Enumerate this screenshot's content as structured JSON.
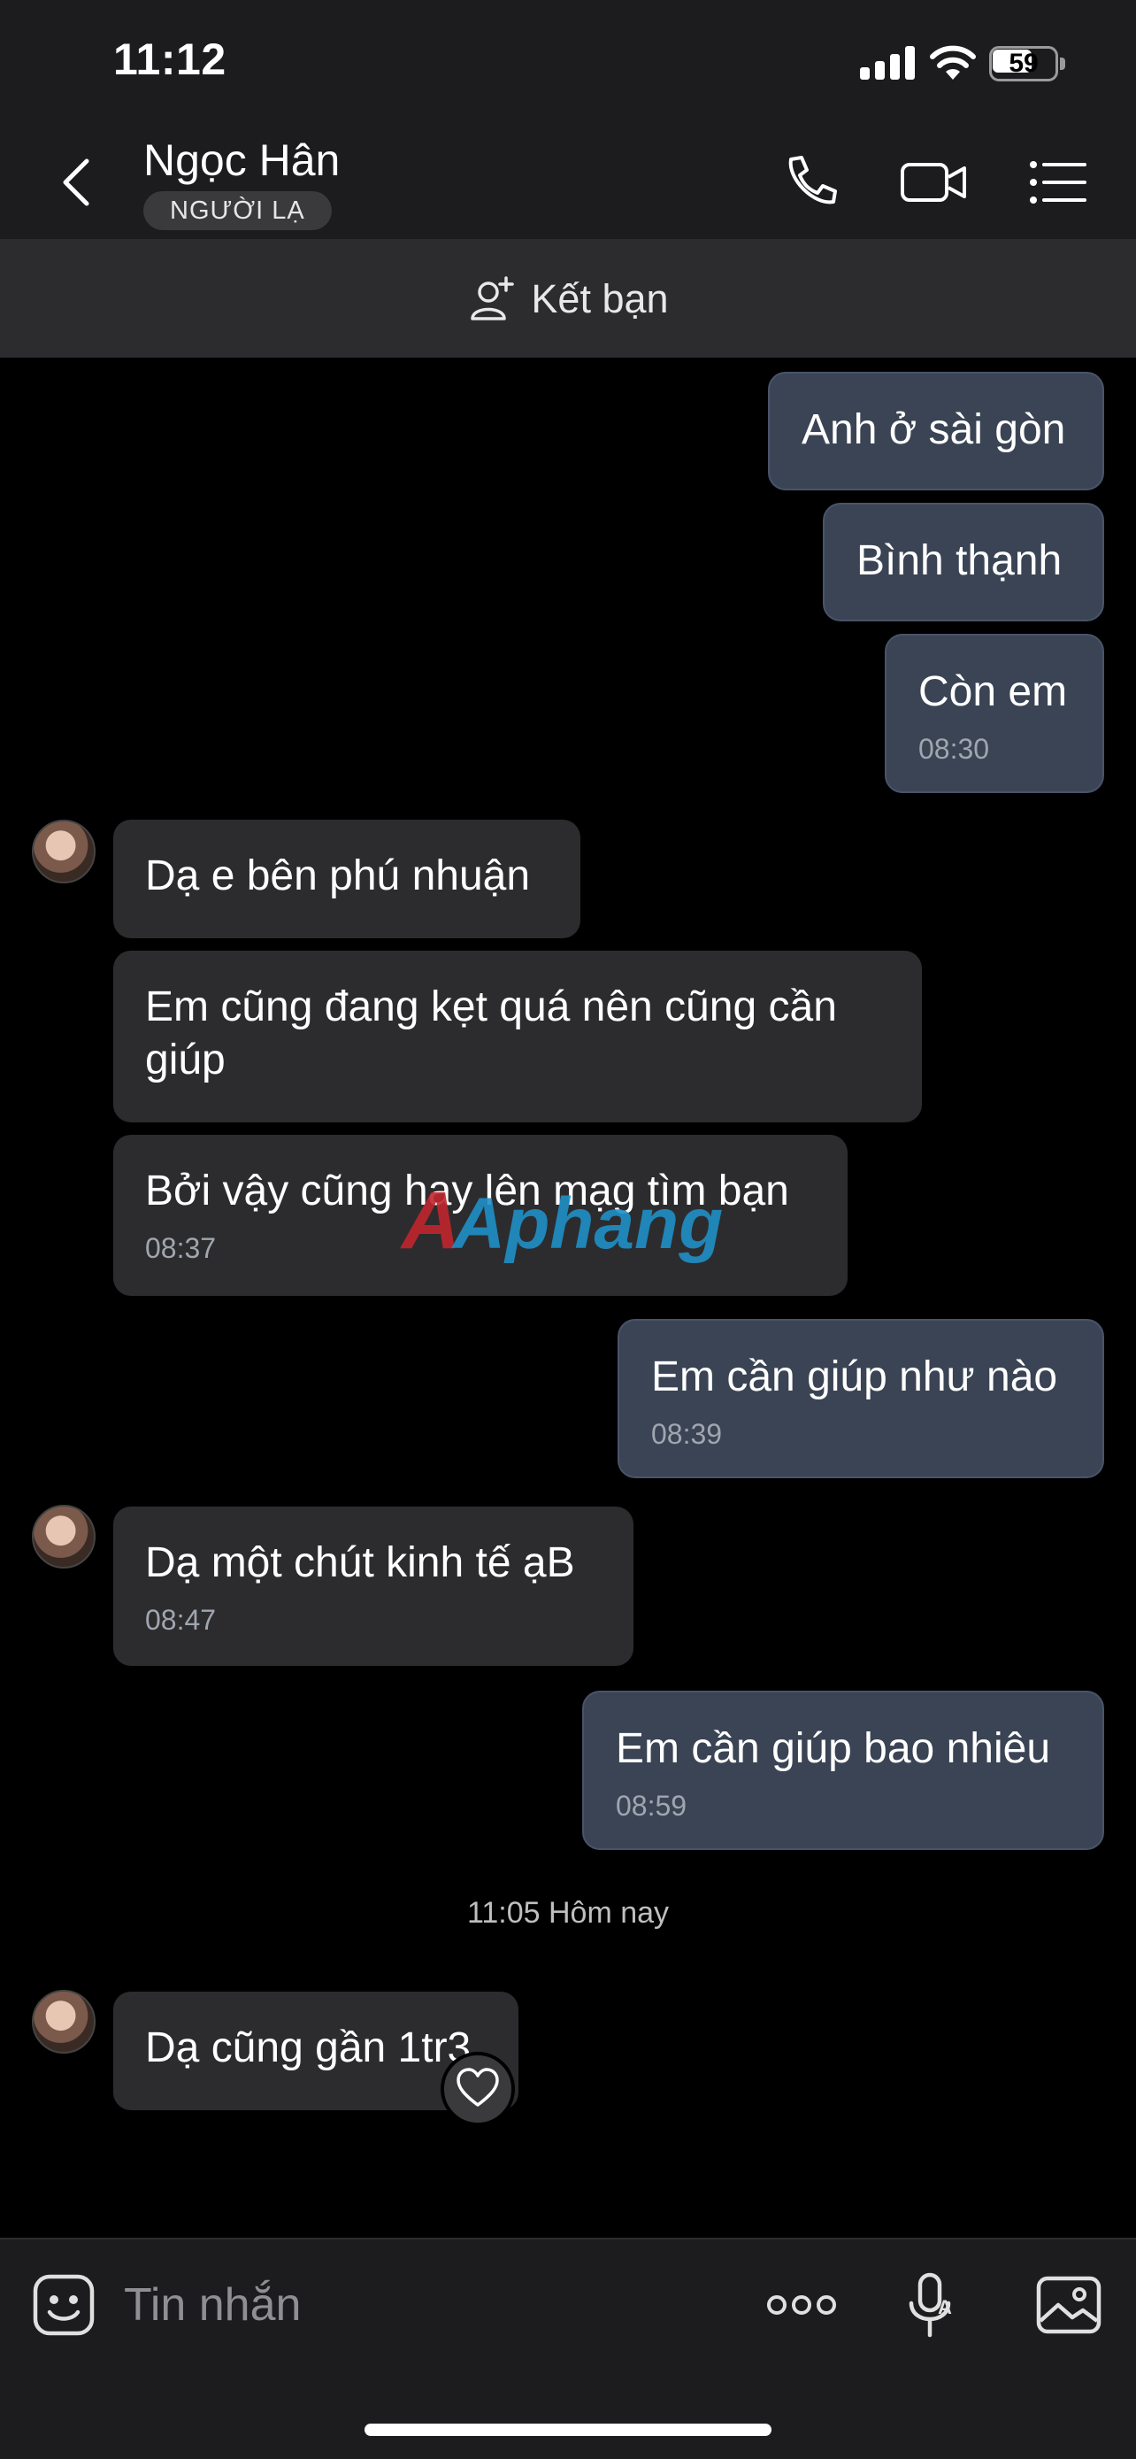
{
  "status_bar": {
    "time": "11:12",
    "battery": "59"
  },
  "header": {
    "contact_name": "Ngọc Hân",
    "badge": "NGƯỜI LẠ"
  },
  "friend_bar": {
    "label": "Kết bạn"
  },
  "messages": [
    {
      "dir": "out",
      "text": "Anh ở sài gòn",
      "time": ""
    },
    {
      "dir": "out",
      "text": "Bình thạnh",
      "time": ""
    },
    {
      "dir": "out",
      "text": "Còn em",
      "time": "08:30"
    },
    {
      "dir": "in",
      "text": "Dạ e bên phú nhuận",
      "time": ""
    },
    {
      "dir": "in",
      "text": "Em cũng đang kẹt quá nên cũng cần giúp",
      "time": ""
    },
    {
      "dir": "in",
      "text": "Bởi vậy cũng hay lên mạg tìm bạn",
      "time": "08:37"
    },
    {
      "dir": "out",
      "text": "Em cần giúp như nào",
      "time": "08:39"
    },
    {
      "dir": "in",
      "text": "Dạ một chút kinh tế ạB",
      "time": "08:47"
    },
    {
      "dir": "out",
      "text": "Em cần giúp bao nhiêu",
      "time": "08:59"
    },
    {
      "dir": "in",
      "text": "Dạ cũng gần 1tr3",
      "time": ""
    }
  ],
  "date_separator": "11:05 Hôm nay",
  "watermark": "Aphang",
  "input": {
    "placeholder": "Tin nhắn"
  },
  "colors": {
    "outgoing_bubble": "#3a4454",
    "incoming_bubble": "#2c2c2e",
    "background": "#000000",
    "bar": "#1c1c1e"
  }
}
